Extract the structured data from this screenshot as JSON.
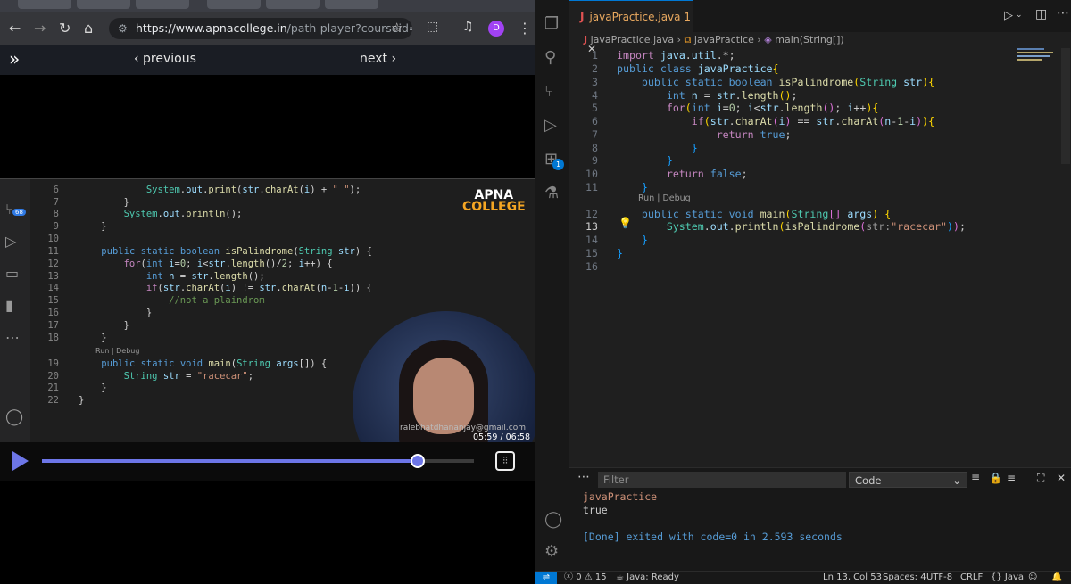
{
  "browser": {
    "url_host": "https://www.apnacollege.in",
    "url_path": "/path-player?courseid=alph...",
    "profile_initial": "D",
    "nav": {
      "previous": "‹ previous",
      "next": "next ›"
    },
    "video": {
      "logo_top": "APNA",
      "logo_bottom": "COLLEGE",
      "badge": "68",
      "email_watermark": "ralebhatdhananjay@gmail.com",
      "time": "05:59 / 06:58",
      "progress": 0.87,
      "codelens": "Run | Debug",
      "lines": [
        {
          "n": "6",
          "text": "System.out.print(str.charAt(i) + \" \");"
        },
        {
          "n": "7",
          "text": "}"
        },
        {
          "n": "8",
          "text": "System.out.println();"
        },
        {
          "n": "9",
          "text": "}"
        },
        {
          "n": "10",
          "text": ""
        },
        {
          "n": "11",
          "text": "public static boolean isPalindrome(String str) {"
        },
        {
          "n": "12",
          "text": "for(int i=0; i<str.length()/2; i++) {"
        },
        {
          "n": "13",
          "text": "int n = str.length();"
        },
        {
          "n": "14",
          "text": "if(str.charAt(i) != str.charAt(n-1-i)) {"
        },
        {
          "n": "15",
          "text": "//not a plaindrom"
        },
        {
          "n": "16",
          "text": "}"
        },
        {
          "n": "17",
          "text": "}"
        },
        {
          "n": "18",
          "text": "}"
        },
        {
          "n": "19",
          "text": "public static void main(String args[]) {"
        },
        {
          "n": "20",
          "text": "String str = \"racecar\";"
        },
        {
          "n": "21",
          "text": "}"
        },
        {
          "n": "22",
          "text": "}"
        }
      ]
    }
  },
  "vscode": {
    "tab_label": "javaPractice.java",
    "tab_count": "1",
    "breadcrumb": {
      "file": "javaPractice.java",
      "class": "javaPractice",
      "method": "main(String[])"
    },
    "codelens": "Run | Debug",
    "extensions_badge": "1",
    "code_lines": [
      {
        "n": "1",
        "text": "import java.util.*;"
      },
      {
        "n": "2",
        "text": "public class javaPractice{"
      },
      {
        "n": "3",
        "text": "public static boolean isPalindrome(String str){"
      },
      {
        "n": "4",
        "text": "int n = str.length();"
      },
      {
        "n": "5",
        "text": "for(int i=0; i<str.length(); i++){"
      },
      {
        "n": "6",
        "text": "if(str.charAt(i) == str.charAt(n-1-i)){"
      },
      {
        "n": "7",
        "text": "return true;"
      },
      {
        "n": "8",
        "text": "}"
      },
      {
        "n": "9",
        "text": "}"
      },
      {
        "n": "10",
        "text": "return false;"
      },
      {
        "n": "11",
        "text": "}"
      },
      {
        "n": "12",
        "text": "public static void main(String[] args) {"
      },
      {
        "n": "13",
        "text": "System.out.println(isPalindrome(str:\"racecar\"));"
      },
      {
        "n": "14",
        "text": "}"
      },
      {
        "n": "15",
        "text": "}"
      },
      {
        "n": "16",
        "text": ""
      }
    ],
    "panel": {
      "filter_placeholder": "Filter",
      "channel": "Code",
      "output": [
        "javaPractice",
        "true",
        "",
        "[Done] exited with code=0 in 2.593 seconds"
      ]
    },
    "status": {
      "errors": "0",
      "warnings": "15",
      "java": "Java: Ready",
      "position": "Ln 13, Col 53",
      "spaces": "Spaces: 4",
      "encoding": "UTF-8",
      "eol": "CRLF",
      "language": "{} Java"
    }
  }
}
